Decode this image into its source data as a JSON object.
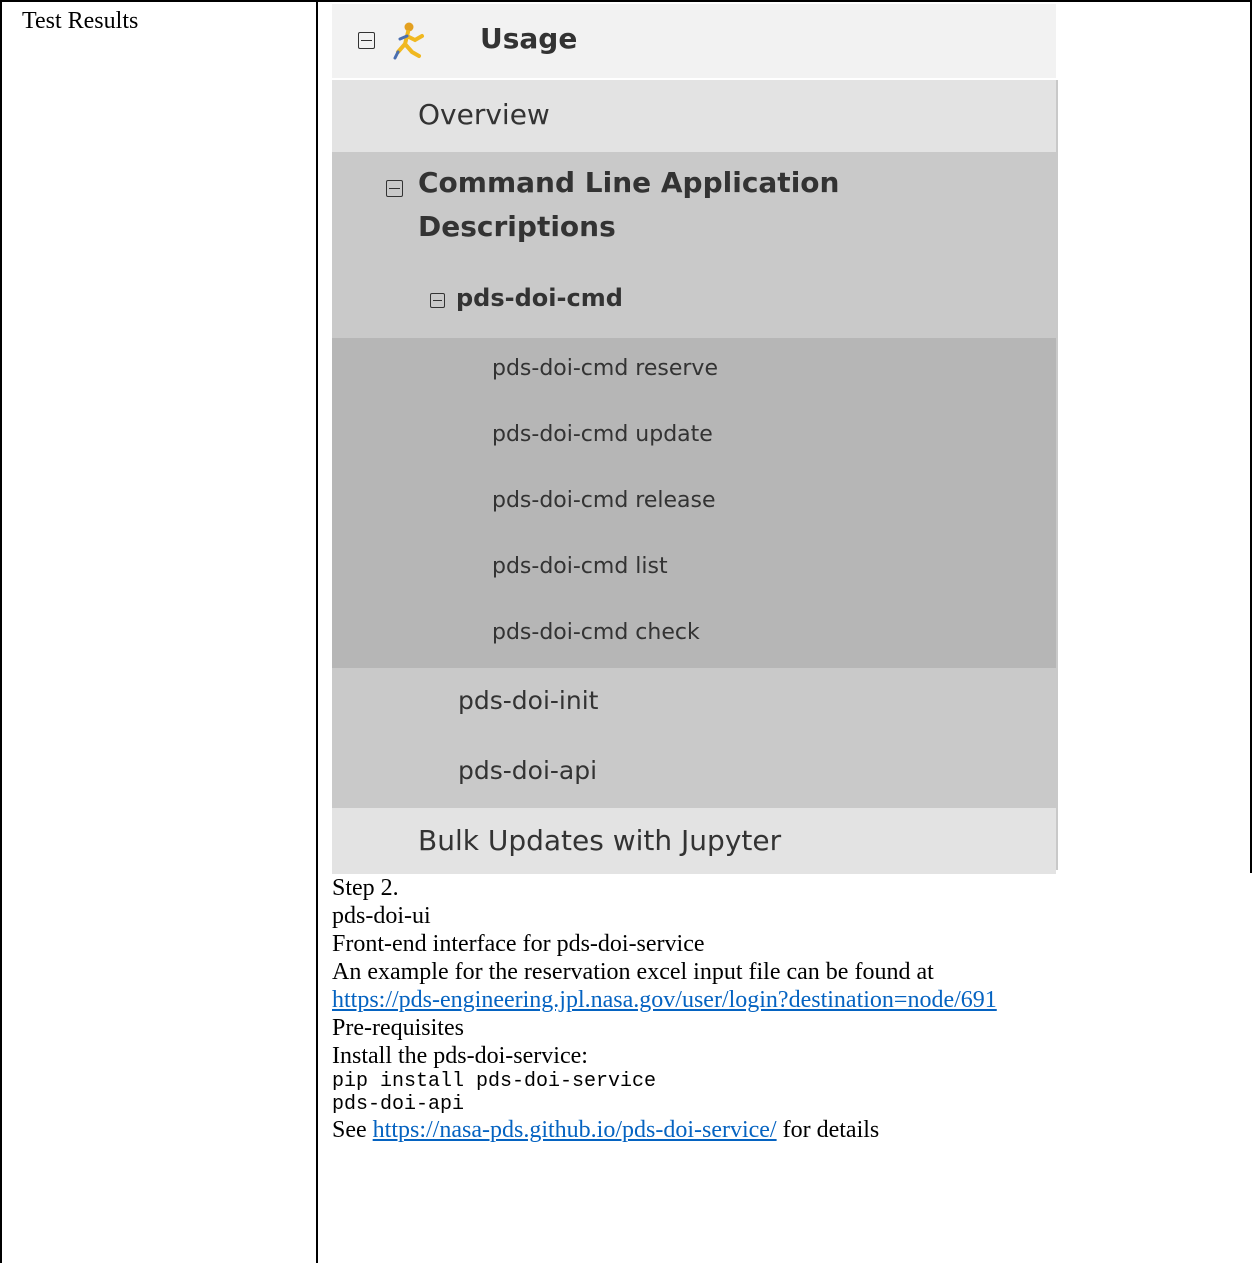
{
  "table": {
    "label": "Test Results"
  },
  "sidebar": {
    "section_title": "Usage",
    "section_icon": "figure-icon",
    "overview": "Overview",
    "cla_line1": "Command Line Application",
    "cla_line2": "Descriptions",
    "cmd_group": "pds-doi-cmd",
    "cmd_items": [
      "pds-doi-cmd reserve",
      "pds-doi-cmd update",
      "pds-doi-cmd release",
      "pds-doi-cmd list",
      "pds-doi-cmd check"
    ],
    "init": "pds-doi-init",
    "api": "pds-doi-api",
    "bulk": "Bulk Updates with Jupyter"
  },
  "content": {
    "step": "Step 2.",
    "title": "pds-doi-ui",
    "subtitle": "Front-end interface for pds-doi-service",
    "example_text": "An example for the reservation excel input file can be found at",
    "example_link": "https://pds-engineering.jpl.nasa.gov/user/login?destination=node/691",
    "prereq": "Pre-requisites",
    "install_text": "Install the pds-doi-service:",
    "code_line1": "pip install pds-doi-service",
    "code_line2": "pds-doi-api",
    "see_prefix": "See ",
    "see_link": "https://nasa-pds.github.io/pds-doi-service/",
    "see_suffix": " for details"
  }
}
